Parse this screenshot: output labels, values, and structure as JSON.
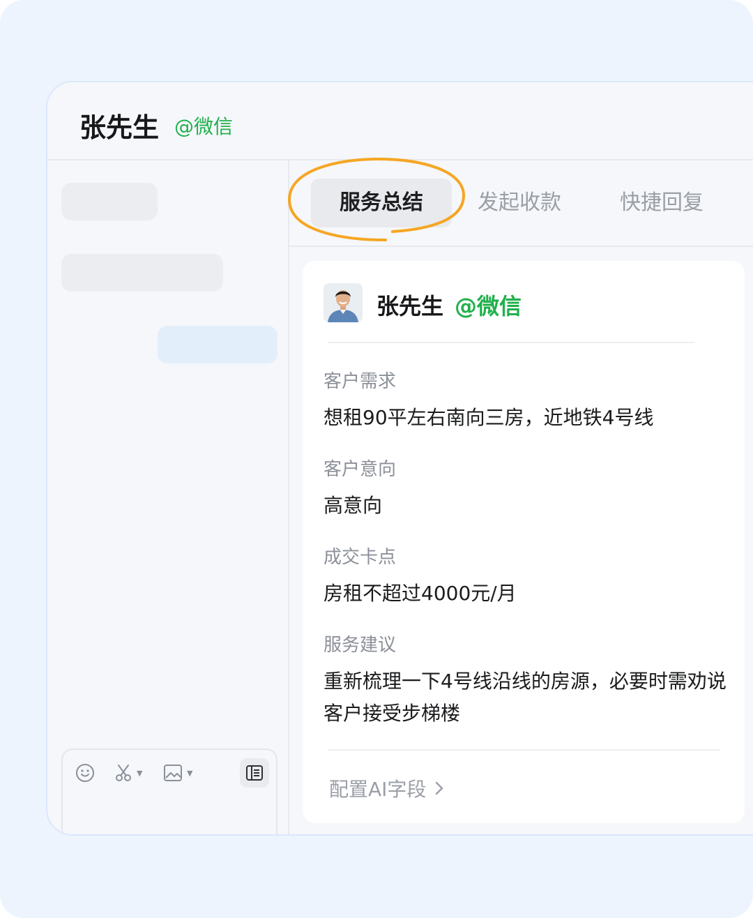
{
  "header": {
    "contact_name": "张先生",
    "contact_source": "@微信"
  },
  "tabs": [
    {
      "label": "服务总结",
      "active": true
    },
    {
      "label": "发起收款",
      "active": false
    },
    {
      "label": "快捷回复",
      "active": false
    }
  ],
  "summary_card": {
    "name": "张先生",
    "source": "@微信",
    "fields": [
      {
        "label": "客户需求",
        "value": "想租90平左右南向三房，近地铁4号线"
      },
      {
        "label": "客户意向",
        "value": "高意向"
      },
      {
        "label": "成交卡点",
        "value": "房租不超过4000元/月"
      },
      {
        "label": "服务建议",
        "value": "重新梳理一下4号线沿线的房源，必要时需劝说客户接受步梯楼"
      }
    ],
    "config_link": "配置AI字段"
  },
  "composer": {
    "tools": [
      "emoji-icon",
      "scissors-icon",
      "image-icon",
      "notes-icon"
    ]
  },
  "colors": {
    "accent_green": "#20b04b",
    "highlight_orange": "#f5a623",
    "canvas_bg": "#eef4fd"
  }
}
